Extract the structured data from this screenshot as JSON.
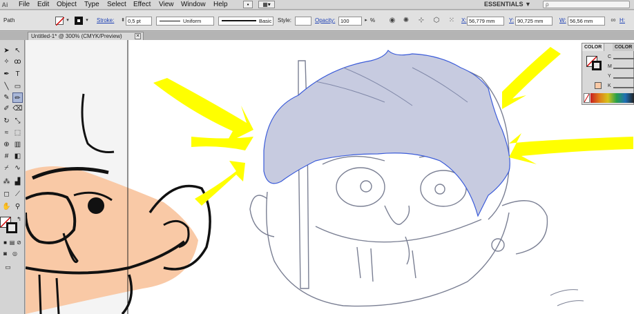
{
  "app": {
    "logo": "Ai"
  },
  "menu": [
    "File",
    "Edit",
    "Object",
    "Type",
    "Select",
    "Effect",
    "View",
    "Window",
    "Help"
  ],
  "workspace": {
    "label": "ESSENTIALS",
    "arrow": "▼"
  },
  "search": {
    "placeholder": "ρ"
  },
  "control": {
    "selection_label": "Path",
    "stroke_label": "Stroke:",
    "stroke_weight": "0,5 pt",
    "profile": "Uniform",
    "brush": "Basic",
    "style_label": "Style:",
    "opacity_label": "Opacity:",
    "opacity_value": "100",
    "percent": "%",
    "x_label": "X:",
    "x_value": "56,779 mm",
    "y_label": "Y:",
    "y_value": "90,725 mm",
    "w_label": "W:",
    "w_value": "56,56 mm",
    "h_label": "H:"
  },
  "document": {
    "tab_title": "Untitled-1* @ 300% (CMYK/Preview)",
    "close": "✕"
  },
  "color_panel": {
    "tabs": [
      "COLOR",
      "COLOR"
    ],
    "channels": [
      "C",
      "M",
      "Y",
      "K"
    ]
  },
  "colors": {
    "accent_blue": "#1d40b5",
    "arrow_yellow": "#ffff00",
    "skin": "#f9c9a6",
    "pencil": "#6b6f7f",
    "path_blue": "#3a5bd9"
  }
}
